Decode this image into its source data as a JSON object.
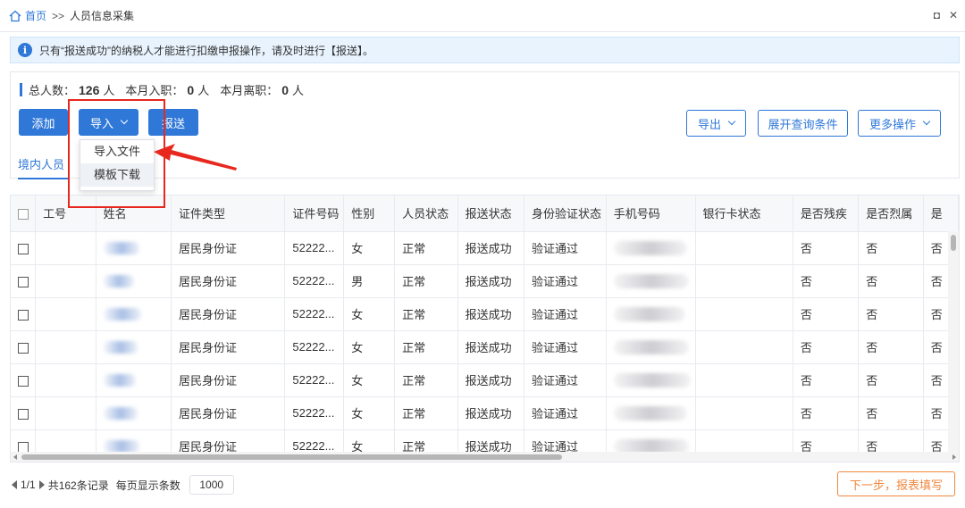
{
  "breadcrumb": {
    "home": "首页",
    "sep": ">>",
    "current": "人员信息采集"
  },
  "window": {
    "restore_glyph": "◘",
    "close_glyph": "✕"
  },
  "notice": {
    "icon_glyph": "i",
    "text": "只有“报送成功”的纳税人才能进行扣缴申报操作，请及时进行【报送】。"
  },
  "stats": {
    "total_label": "总人数：",
    "total_value": "126",
    "total_unit": "人",
    "hired_label": "本月入职：",
    "hired_value": "0",
    "hired_unit": "人",
    "left_label": "本月离职：",
    "left_value": "0",
    "left_unit": "人"
  },
  "toolbar": {
    "add": "添加",
    "import": "导入",
    "report": "报送",
    "export": "导出",
    "expand_query": "展开查询条件",
    "more": "更多操作"
  },
  "import_menu": {
    "items": [
      "导入文件",
      "模板下载"
    ]
  },
  "tabs": {
    "domestic": "境内人员"
  },
  "table": {
    "headers": [
      "工号",
      "姓名",
      "证件类型",
      "证件号码",
      "性别",
      "人员状态",
      "报送状态",
      "身份验证状态",
      "手机号码",
      "银行卡状态",
      "是否残疾",
      "是否烈属",
      "是"
    ],
    "rows": [
      {
        "id_type": "居民身份证",
        "id_no": "52222...",
        "gender": "女",
        "status": "正常",
        "report": "报送成功",
        "verify": "验证通过",
        "disabled": "否",
        "martyr": "否",
        "last": "否"
      },
      {
        "id_type": "居民身份证",
        "id_no": "52222...",
        "gender": "男",
        "status": "正常",
        "report": "报送成功",
        "verify": "验证通过",
        "disabled": "否",
        "martyr": "否",
        "last": "否"
      },
      {
        "id_type": "居民身份证",
        "id_no": "52222...",
        "gender": "女",
        "status": "正常",
        "report": "报送成功",
        "verify": "验证通过",
        "disabled": "否",
        "martyr": "否",
        "last": "否"
      },
      {
        "id_type": "居民身份证",
        "id_no": "52222...",
        "gender": "女",
        "status": "正常",
        "report": "报送成功",
        "verify": "验证通过",
        "disabled": "否",
        "martyr": "否",
        "last": "否"
      },
      {
        "id_type": "居民身份证",
        "id_no": "52222...",
        "gender": "女",
        "status": "正常",
        "report": "报送成功",
        "verify": "验证通过",
        "disabled": "否",
        "martyr": "否",
        "last": "否"
      },
      {
        "id_type": "居民身份证",
        "id_no": "52222...",
        "gender": "女",
        "status": "正常",
        "report": "报送成功",
        "verify": "验证通过",
        "disabled": "否",
        "martyr": "否",
        "last": "否"
      },
      {
        "id_type": "居民身份证",
        "id_no": "52222...",
        "gender": "女",
        "status": "正常",
        "report": "报送成功",
        "verify": "验证通过",
        "disabled": "否",
        "martyr": "否",
        "last": "否"
      }
    ]
  },
  "pager": {
    "page": "1/1",
    "total": "共162条记录",
    "per_page_label": "每页显示条数",
    "per_page_value": "1000"
  },
  "next_button": "下一步，报表填写",
  "colors": {
    "primary": "#2f78d8",
    "accent_orange": "#f0883e",
    "annotation_red": "#e8281e",
    "notice_bg": "#e8f3fd"
  }
}
